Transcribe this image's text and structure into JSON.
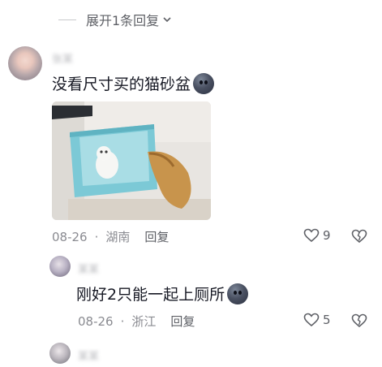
{
  "expand_replies": {
    "label": "展开1条回复"
  },
  "comments": [
    {
      "username": "张某",
      "text": "没看尺寸买的猫砂盆",
      "emoji_icon": "dark-face-emoji",
      "date": "08-26",
      "location": "湖南",
      "reply_label": "回复",
      "like_count": "9"
    },
    {
      "username": "某某",
      "text": "刚好2只能一起上厕所",
      "emoji_icon": "dark-face-emoji",
      "date": "08-26",
      "location": "浙江",
      "reply_label": "回复",
      "like_count": "5"
    },
    {
      "username": "某某"
    }
  ],
  "colors": {
    "text": "#161823",
    "meta": "#8a8b91",
    "reply": "#5e6066",
    "litter_box": "#7cc9d6"
  }
}
